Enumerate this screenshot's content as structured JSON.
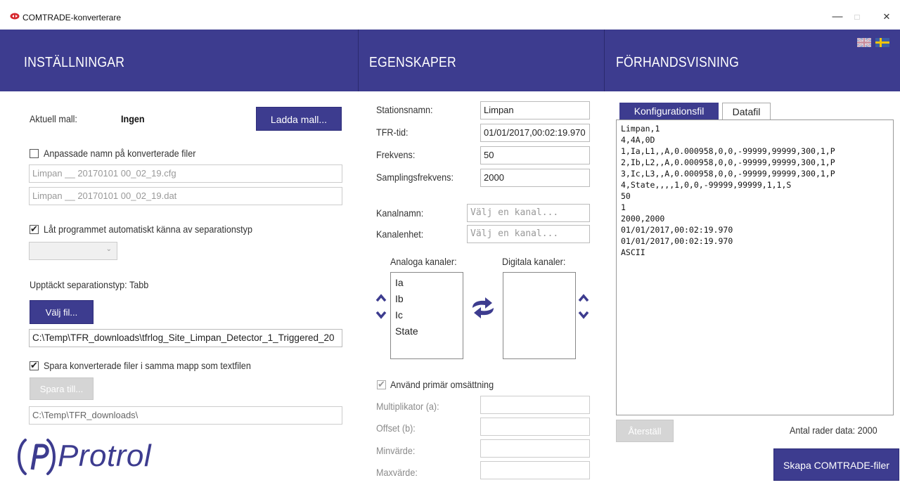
{
  "window": {
    "title": "COMTRADE-konverterare",
    "minimize": "—",
    "maximize": "□",
    "close": "✕"
  },
  "sections": {
    "settings": "INSTÄLLNINGAR",
    "properties": "EGENSKAPER",
    "preview": "FÖRHANDSVISNING"
  },
  "settings": {
    "current_template_label": "Aktuell mall:",
    "current_template_value": "Ingen",
    "load_template_button": "Ladda mall...",
    "custom_names_label": "Anpassade namn på konverterade filer",
    "custom_names_checked": false,
    "cfg_filename": "Limpan __ 20170101 00_02_19.cfg",
    "dat_filename": "Limpan __ 20170101 00_02_19.dat",
    "auto_detect_label": "Låt programmet automatiskt känna av separationstyp",
    "auto_detect_checked": true,
    "detected_separator_label": "Upptäckt separationstyp: Tabb",
    "choose_file_button": "Välj fil...",
    "file_path": "C:\\Temp\\TFR_downloads\\tfrlog_Site_Limpan_Detector_1_Triggered_20",
    "save_same_folder_label": "Spara konverterade filer i samma mapp som textfilen",
    "save_same_folder_checked": true,
    "save_to_button": "Spara till...",
    "save_path": "C:\\Temp\\TFR_downloads\\",
    "brand": "Protrol"
  },
  "properties": {
    "station_name_label": "Stationsnamn:",
    "station_name_value": "Limpan",
    "tfr_time_label": "TFR-tid:",
    "tfr_time_value": "01/01/2017,00:02:19.970",
    "frequency_label": "Frekvens:",
    "frequency_value": "50",
    "sampling_label": "Samplingsfrekvens:",
    "sampling_value": "2000",
    "channel_name_label": "Kanalnamn:",
    "channel_name_placeholder": "Välj en kanal...",
    "channel_unit_label": "Kanalenhet:",
    "channel_unit_placeholder": "Välj en kanal...",
    "analog_label": "Analoga kanaler:",
    "digital_label": "Digitala kanaler:",
    "analog_channels": [
      "Ia",
      "Ib",
      "Ic",
      "State"
    ],
    "use_primary_label": "Använd primär omsättning",
    "use_primary_checked": true,
    "multiplier_label": "Multiplikator (a):",
    "offset_label": "Offset (b):",
    "min_label": "Minvärde:",
    "max_label": "Maxvärde:"
  },
  "preview": {
    "tab_config": "Konfigurationsfil",
    "tab_data": "Datafil",
    "lines": [
      "Limpan,1",
      "4,4A,0D",
      "1,Ia,L1,,A,0.000958,0,0,-99999,99999,300,1,P",
      "2,Ib,L2,,A,0.000958,0,0,-99999,99999,300,1,P",
      "3,Ic,L3,,A,0.000958,0,0,-99999,99999,300,1,P",
      "4,State,,,,1,0,0,-99999,99999,1,1,S",
      "50",
      "1",
      "2000,2000",
      "01/01/2017,00:02:19.970",
      "01/01/2017,00:02:19.970",
      "ASCII"
    ],
    "reset_button": "Återställ",
    "row_count": "Antal rader data: 2000",
    "create_button": "Skapa COMTRADE-filer"
  },
  "colors": {
    "brand_purple": "#3d3c8f",
    "brand_red": "#d6262c"
  }
}
